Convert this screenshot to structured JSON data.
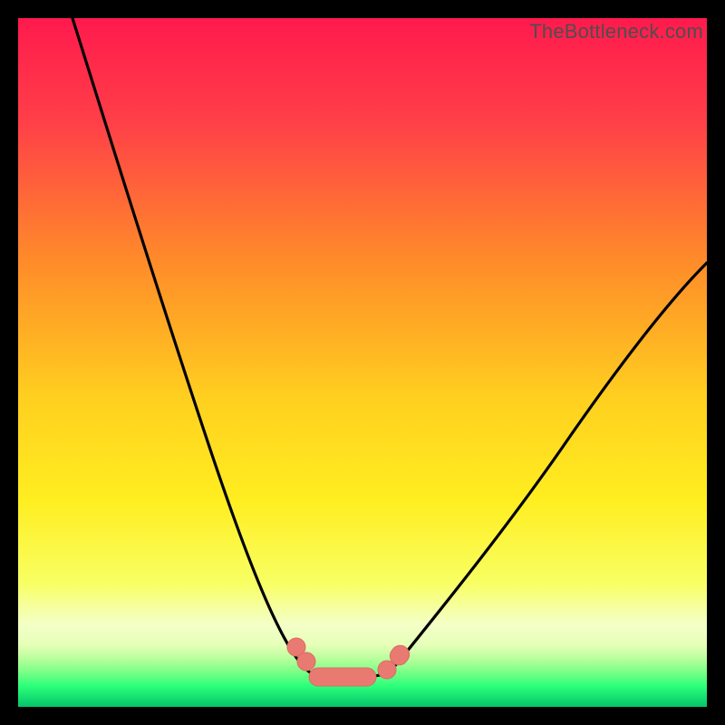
{
  "watermark": "TheBottleneck.com",
  "colors": {
    "top": "#ff1a4d",
    "mid_upper": "#ff8a2a",
    "mid": "#ffe600",
    "mid_lower": "#f7ff66",
    "pale": "#f4ffd0",
    "green": "#2bff7a",
    "deep_green": "#03c46a",
    "curve_stroke": "#000000",
    "marker_fill": "#e97a72",
    "marker_stroke": "#c95b55"
  },
  "chart_data": {
    "type": "line",
    "title": "",
    "xlabel": "",
    "ylabel": "",
    "x_range": [
      0,
      100
    ],
    "y_range": [
      0,
      100
    ],
    "note": "Bottleneck-style V curve. y ≈ bottleneck % (0 at valley, ~100 at top). Left branch descends from top-left, right branch ascends to ~60% at right edge. Valley floor ≈ x 41–52 at y≈0.",
    "series": [
      {
        "name": "bottleneck-curve",
        "x": [
          8,
          12,
          16,
          20,
          24,
          28,
          32,
          36,
          40,
          42,
          44,
          46,
          48,
          50,
          52,
          54,
          58,
          62,
          66,
          72,
          80,
          90,
          100
        ],
        "y": [
          100,
          89,
          78,
          67,
          56,
          45,
          34,
          22,
          8,
          2,
          0,
          0,
          0,
          0,
          1,
          3,
          8,
          14,
          20,
          28,
          38,
          50,
          60
        ]
      }
    ],
    "markers": [
      {
        "x_start": 40.5,
        "x_end": 42.0,
        "y_level": 4
      },
      {
        "x_start": 42.5,
        "x_end": 51.5,
        "y_level": 0
      },
      {
        "x_start": 52.5,
        "x_end": 54.5,
        "y_level": 3
      }
    ]
  }
}
